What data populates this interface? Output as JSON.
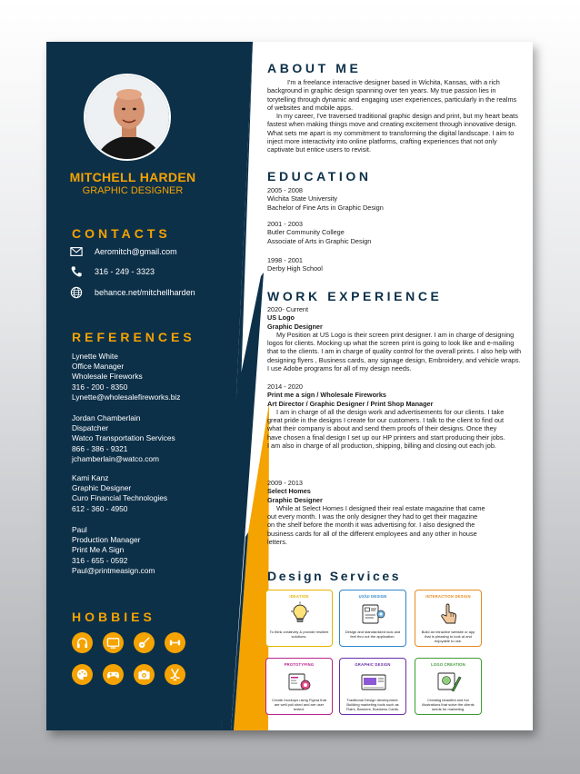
{
  "colors": {
    "navy": "#0d3049",
    "accent": "#f5a300",
    "text": "#1b1b1b"
  },
  "profile": {
    "name": "MITCHELL HARDEN",
    "title": "GRAPHIC DESIGNER"
  },
  "contacts": {
    "heading": "CONTACTS",
    "items": [
      {
        "icon": "mail-icon",
        "text": "Aeromitch@gmail.com"
      },
      {
        "icon": "phone-icon",
        "text": "316 - 249 - 3323"
      },
      {
        "icon": "globe-icon",
        "text": "behance.net/mitchellharden"
      }
    ]
  },
  "references": {
    "heading": "REFERENCES",
    "items": [
      {
        "lines": [
          "Lynette White",
          "Office Manager",
          "Wholesale Fireworks",
          "316 - 200 - 8350",
          "Lynette@wholesalefireworks.biz"
        ]
      },
      {
        "lines": [
          "Jordan Chamberlain",
          "Dispatcher",
          "Watco Transportation Services",
          "866 - 386 - 9321",
          "jchamberlain@watco.com"
        ]
      },
      {
        "lines": [
          "Kami Kanz",
          "Graphic Designer",
          "Curo Financial Technologies",
          "612 - 360 - 4950"
        ]
      },
      {
        "lines": [
          "Paul",
          "Production Manager",
          "Print Me A Sign",
          "316 - 655 - 0592",
          "Paul@printmeasign.com"
        ]
      }
    ]
  },
  "hobbies": {
    "heading": "HOBBIES",
    "icons": [
      "headphones-icon",
      "tv-icon",
      "guitar-icon",
      "dumbbell-icon",
      "palette-icon",
      "gamepad-icon",
      "camera-icon",
      "hockey-icon"
    ]
  },
  "about": {
    "heading": "ABOUT ME",
    "p1": "I'm a freelance interactive designer based in Wichita, Kansas, with a rich background in graphic design spanning over ten years. My true passion lies in torytelling through dynamic and engaging user experiences, particularly in the realms of websites and mobile apps.",
    "p2": "In my career, I've traversed traditional graphic design and print, but my heart beats fastest when making things move and creating excitement through innovative design. What sets me apart is my commitment to transforming the digital landscape. I aim to inject more interactivity into online platforms, crafting experiences that not only captivate but entice users to revisit."
  },
  "education": {
    "heading": "EDUCATION",
    "items": [
      {
        "years": "2005 - 2008",
        "school": "Wichita State University",
        "degree": "Bachelor of Fine Arts in Graphic Design"
      },
      {
        "years": "2001 - 2003",
        "school": "Butler Community College",
        "degree": "Associate of Arts in Graphic Design"
      },
      {
        "years": "1998 - 2001",
        "school": "Derby High School",
        "degree": ""
      }
    ]
  },
  "work": {
    "heading": "WORK EXPERIENCE",
    "jobs": [
      {
        "years": "2020- Current",
        "company": "US Logo",
        "role": "Graphic Designer",
        "desc": "My Position at US Logo is their screen print designer. I am in charge of designing logos for clients. Mocking up what the screen print is going to look like and e-mailing that to the clients. I am in charge of quality control for the overall prints. I also help with designing flyers , Business cards, any signage design, Embroidery, and vehicle wraps. I use Adobe programs for all of my design needs."
      },
      {
        "years": "2014 - 2020",
        "company": "Print me a sign / Wholesale Fireworks",
        "role": "Art  Director / Graphic Designer / Print Shop Manager",
        "desc": "I am in charge of all the design work and advertisements for our clients. I take great pride in the designs I create for our customers. I talk to the client to find out what their company is about and send them proofs of their designs. Once they have chosen a final design I set up our HP printers and start producing their jobs. I am also in charge of all production, shipping, billing and closing out each job."
      },
      {
        "years": "2009 - 2013",
        "company": "Select Homes",
        "role": "Graphic Designer",
        "desc": "While at Select Homes I designed their real estate magazine that came out every month. I was the only designer they had to get their magazine on the shelf before the month it was advertising for. I also designed the business cards for all of the different employees and any other in house letters."
      }
    ]
  },
  "services": {
    "heading": "Design Services",
    "cards": [
      {
        "title": "IDEATION",
        "icon": "lightbulb-icon",
        "color": "#e5b400",
        "desc": "To think creatively & provide resilient solutions."
      },
      {
        "title": "UX/UI DESIGN",
        "icon": "wireframe-icon",
        "color": "#2f86c9",
        "desc": "Design and standardized look and feel thru out the application."
      },
      {
        "title": "INTERACTION DESIGN",
        "icon": "pointer-hand-icon",
        "color": "#e8891e",
        "desc": "Build an intractive website or app that is pleasing to look at and enjoyable to use."
      },
      {
        "title": "PROTOTYPING",
        "icon": "prototype-icon",
        "color": "#b8238c",
        "desc": "Create mockups using Figma that are well poli shed and are user tested."
      },
      {
        "title": "GRAPHIC DESIGN",
        "icon": "layout-icon",
        "color": "#6a2fa8",
        "desc": "Traditional Design development. Building marketing tools such as Flairs, Banners, Business Cards."
      },
      {
        "title": "LOGO CREATION",
        "icon": "logo-pen-icon",
        "color": "#3f9c35",
        "desc": "Creating beautiful and fun illustrations that solve the clients needs for marketing."
      }
    ]
  }
}
